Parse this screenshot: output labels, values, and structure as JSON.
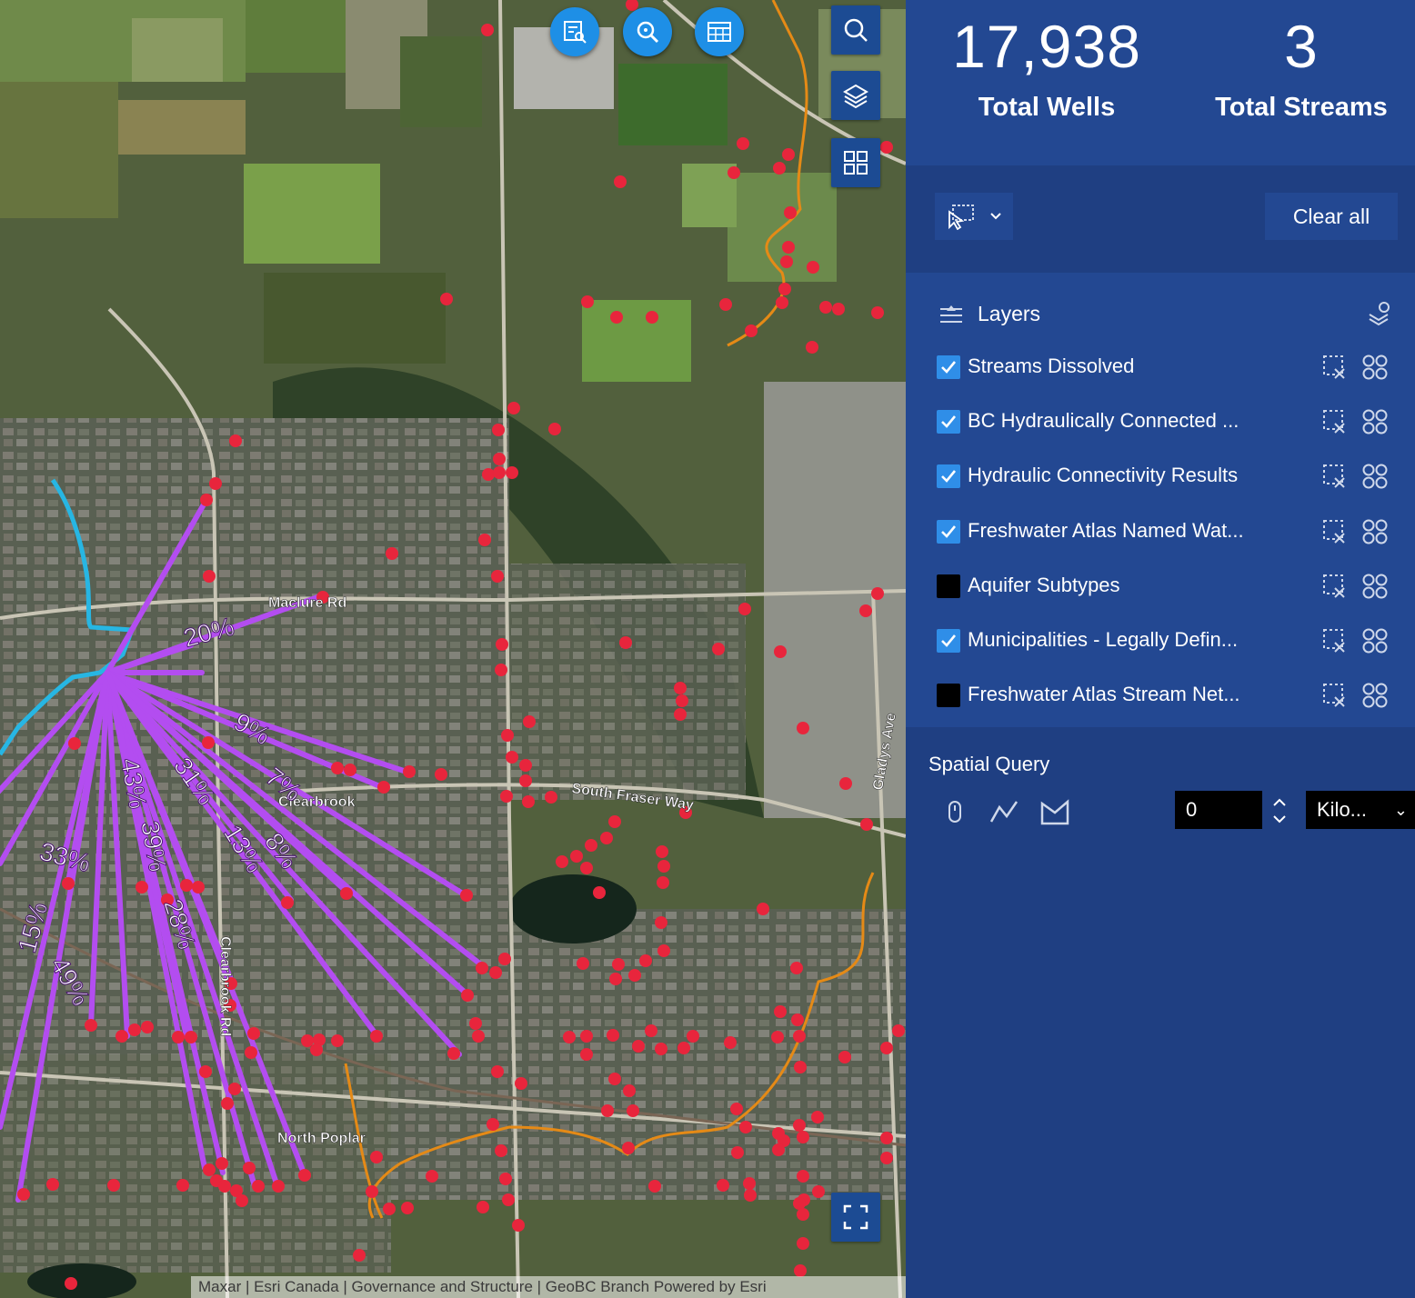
{
  "stats": {
    "wells_value": "17,938",
    "wells_label": "Total Wells",
    "streams_value": "3",
    "streams_label": "Total Streams"
  },
  "toolbar": {
    "select_tool_icon": "select-pointer-icon",
    "clear_all_label": "Clear all"
  },
  "layers": {
    "title": "Layers",
    "items": [
      {
        "label": "Streams Dissolved",
        "checked": true
      },
      {
        "label": "BC Hydraulically Connected ...",
        "checked": true
      },
      {
        "label": "Hydraulic Connectivity Results",
        "checked": true
      },
      {
        "label": "Freshwater Atlas Named Wat...",
        "checked": true
      },
      {
        "label": "Aquifer Subtypes",
        "checked": false
      },
      {
        "label": "Municipalities - Legally Defin...",
        "checked": true
      },
      {
        "label": "Freshwater Atlas Stream Net...",
        "checked": false
      }
    ]
  },
  "spatial_query": {
    "title": "Spatial Query",
    "distance_value": "0",
    "unit_label": "Kilo..."
  },
  "map": {
    "road_labels": [
      "Maclure Rd",
      "Clearbrook",
      "South Fraser Way",
      "North Poplar",
      "Gladys Ave",
      "Clearbrook Rd"
    ],
    "percent_labels": [
      "20%",
      "9%",
      "7%",
      "31%",
      "43%",
      "39%",
      "8%",
      "13%",
      "33%",
      "28%",
      "15%",
      "49%"
    ],
    "attribution": "Maxar | Esri Canada | Governance and Structure | GeoBC Branch    Powered by Esri",
    "colors": {
      "wells": "#e8253c",
      "connectivity": "#b34df0",
      "stream": "#27b6e3",
      "municipality": "#e58a16"
    }
  }
}
